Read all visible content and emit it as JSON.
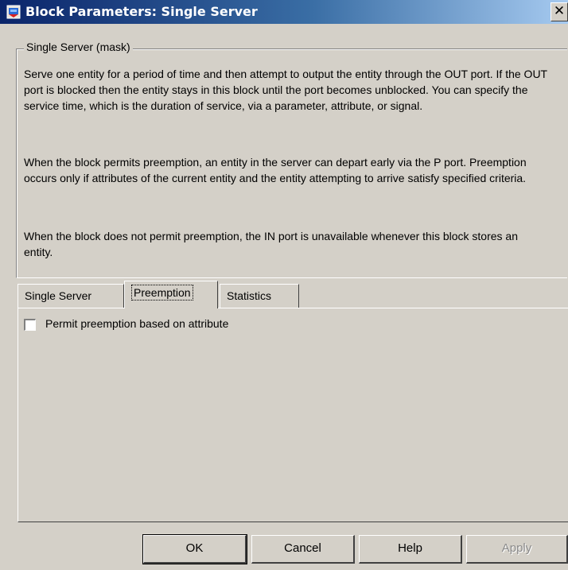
{
  "window": {
    "title": "Block Parameters: Single Server",
    "close_glyph": "✕"
  },
  "mask": {
    "group_label": "Single Server (mask)",
    "paragraphs": [
      "Serve one entity for a period of time and then attempt to output the entity through the OUT port. If the OUT port is blocked then the entity stays in this block until the port becomes unblocked. You can specify the service time, which is the duration of service, via a parameter, attribute, or signal.",
      "When the block permits preemption, an entity in the server can depart early via the P port. Preemption occurs only if attributes of the current entity and the entity attempting to arrive satisfy specified criteria.",
      "When the block does not permit preemption, the IN port is unavailable whenever this block stores an entity."
    ]
  },
  "tabs": [
    {
      "label": "Single Server",
      "active": false
    },
    {
      "label": "Preemption",
      "active": true
    },
    {
      "label": "Statistics",
      "active": false
    }
  ],
  "preemption": {
    "permit_label": "Permit preemption based on attribute",
    "permit_checked": false
  },
  "buttons": {
    "ok": "OK",
    "cancel": "Cancel",
    "help": "Help",
    "apply": "Apply"
  },
  "icons": {
    "app": "simulink-block-icon",
    "close": "close-icon"
  },
  "colors": {
    "title_start": "#0a246a",
    "title_end": "#a6caf0",
    "face": "#d4d0c8"
  }
}
